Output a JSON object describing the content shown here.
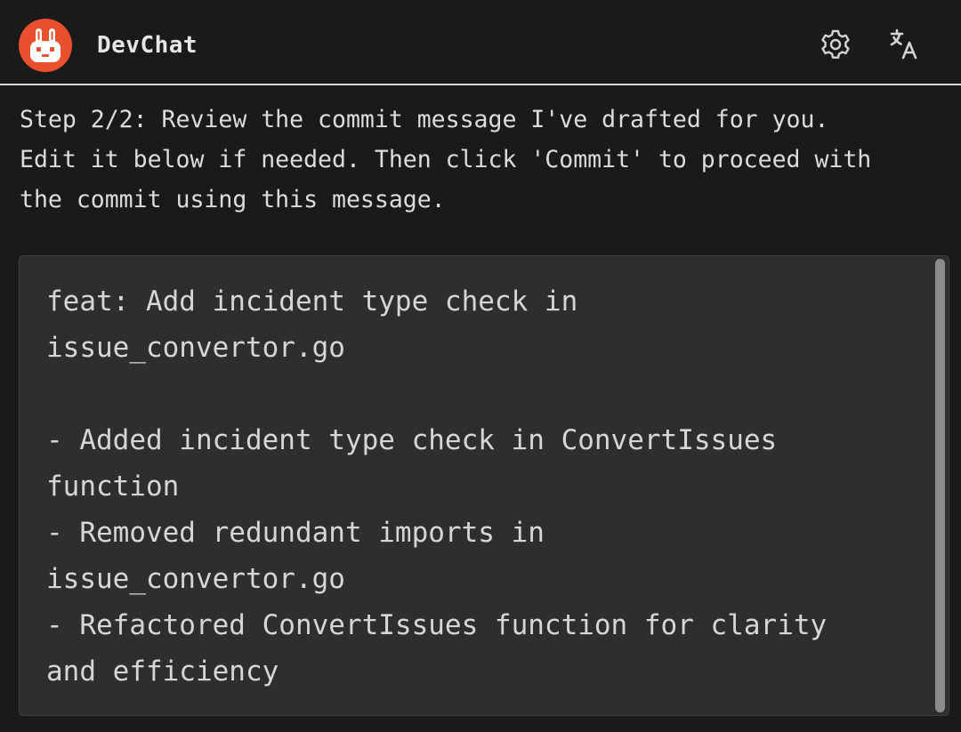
{
  "header": {
    "app_title": "DevChat",
    "logo_icon": "rabbit-logo-icon",
    "settings_icon": "gear-icon",
    "translate_icon": "translate-icon"
  },
  "instruction": {
    "text": "Step 2/2: Review the commit message I've drafted for you.\nEdit it below if needed. Then click 'Commit' to proceed with\nthe commit using this message."
  },
  "commit_editor": {
    "value": "feat: Add incident type check in\nissue_convertor.go\n\n- Added incident type check in ConvertIssues\nfunction\n- Removed redundant imports in\nissue_convertor.go\n- Refactored ConvertIssues function for clarity\nand efficiency"
  },
  "colors": {
    "background": "#1a1a1a",
    "accent": "#e8502e",
    "editor_background": "#2e2e2e",
    "text": "#dcdcdc"
  }
}
